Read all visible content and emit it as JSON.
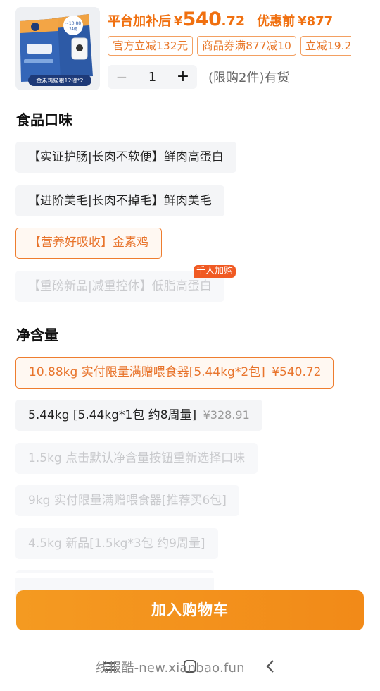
{
  "product": {
    "image_alt": "金素鸡猫粮12磅*2",
    "image_caption": "金素鸡猫粮12磅*2",
    "image_badge": "10.88kg 24磅",
    "price_label": "平台加补后",
    "currency": "¥",
    "price_integer": "540",
    "price_decimal": ".72",
    "original_label": "优惠前",
    "original_price": "¥877"
  },
  "coupons": [
    "官方立减132元",
    "商品券满877减10",
    "立减19.2"
  ],
  "quantity": {
    "minus": "−",
    "value": "1",
    "plus": "+",
    "stock_text": "(限购2件)有货"
  },
  "flavor": {
    "title": "食品口味",
    "options": [
      {
        "label": "【实证护肠|长肉不软便】鲜肉高蛋白",
        "state": "normal"
      },
      {
        "label": "【进阶美毛|长肉不掉毛】鲜肉美毛",
        "state": "normal"
      },
      {
        "label": "【营养好吸收】金素鸡",
        "state": "selected"
      },
      {
        "label": "【重磅新品|减重控体】低脂高蛋白",
        "state": "disabled",
        "badge": "千人加购"
      }
    ]
  },
  "weight": {
    "title": "净含量",
    "options": [
      {
        "label": "10.88kg 实付限量满赠喂食器[5.44kg*2包]",
        "price": "¥540.72",
        "state": "selected"
      },
      {
        "label": "5.44kg [5.44kg*1包 约8周量]",
        "price": "¥328.91",
        "state": "normal"
      },
      {
        "label": "1.5kg 点击默认净含量按钮重新选择口味",
        "state": "disabled"
      },
      {
        "label": "9kg 实付限量满赠喂食器[推荐买6包]",
        "state": "disabled"
      },
      {
        "label": "4.5kg 新品[1.5kg*3包 约9周量]",
        "state": "disabled"
      }
    ]
  },
  "cart_button": "加入购物车",
  "watermark": "线报酷-new.xianbao.fun",
  "colors": {
    "accent": "#f07010",
    "button": "#f2901c",
    "badge": "#f05a23",
    "chip_bg": "#f4f5f7"
  },
  "icons": [
    "minus-icon",
    "plus-icon",
    "menu-icon",
    "home-icon",
    "back-icon"
  ]
}
